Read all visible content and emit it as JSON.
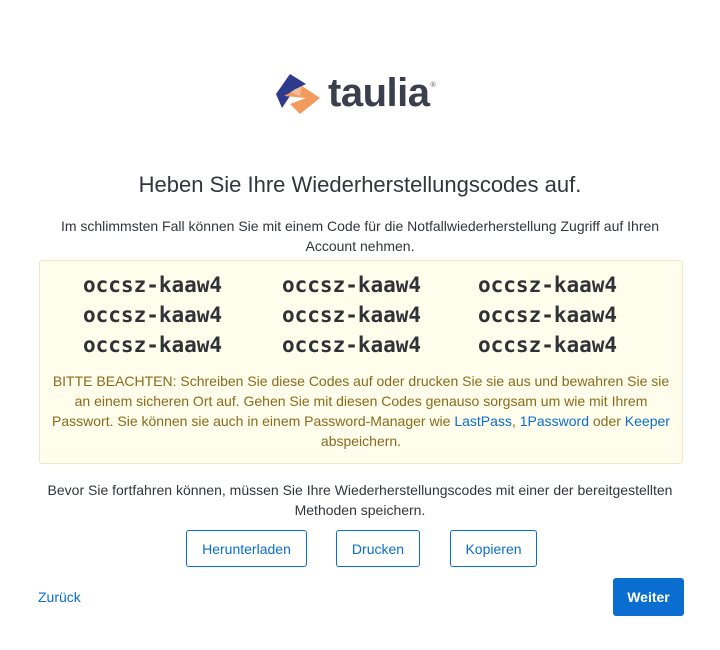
{
  "brand": {
    "name": "taulia",
    "reg_mark": "®",
    "colors": {
      "navy": "#2e3a8c",
      "orange": "#f39a5d",
      "text": "#3b3f4d"
    }
  },
  "heading": "Heben Sie Ihre Wiederherstellungscodes auf.",
  "intro": "Im schlimmsten Fall können Sie mit einem Code für die Notfallwiederherstellung Zugriff auf Ihren Account nehmen.",
  "codes": [
    "occsz-kaaw4",
    "occsz-kaaw4",
    "occsz-kaaw4",
    "occsz-kaaw4",
    "occsz-kaaw4",
    "occsz-kaaw4",
    "occsz-kaaw4",
    "occsz-kaaw4",
    "occsz-kaaw4"
  ],
  "notice": {
    "text": "BITTE BEACHTEN: Schreiben Sie diese Codes auf oder drucken Sie sie aus und bewahren Sie sie an einem sicheren Ort auf. Gehen Sie mit diesen Codes genauso sorgsam um wie mit Ihrem Passwort. Sie können sie auch in einem Password-Manager wie ",
    "link_lastpass": "LastPass",
    "sep1": ", ",
    "link_1password": "1Password",
    "sep2": " oder ",
    "link_keeper": "Keeper",
    "tail": " abspeichern."
  },
  "before_continue": "Bevor Sie fortfahren können, müssen Sie Ihre Wiederherstellungscodes mit einer der bereitgestellten Methoden speichern.",
  "buttons": {
    "download": "Herunterladen",
    "print": "Drucken",
    "copy": "Kopieren",
    "back": "Zurück",
    "next": "Weiter"
  },
  "colors": {
    "primary": "#0a6ed1",
    "notice_bg": "#fffdeb",
    "notice_text": "#8a6a1c"
  }
}
